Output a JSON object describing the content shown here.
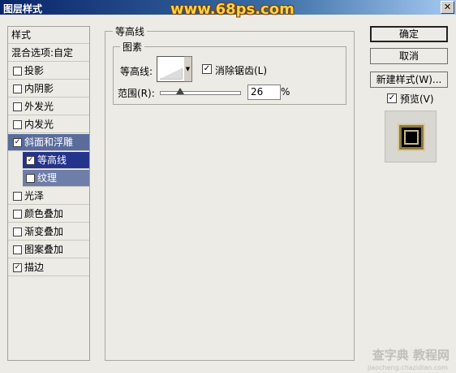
{
  "window": {
    "title": "图层样式",
    "watermark": "www.68ps.com",
    "close_glyph": "✕"
  },
  "styles_list": {
    "header": "样式",
    "blend": "混合选项:自定",
    "items": [
      {
        "label": "投影",
        "checked": false
      },
      {
        "label": "内阴影",
        "checked": false
      },
      {
        "label": "外发光",
        "checked": false
      },
      {
        "label": "内发光",
        "checked": false
      },
      {
        "label": "斜面和浮雕",
        "checked": true
      },
      {
        "label": "等高线",
        "checked": true
      },
      {
        "label": "纹理",
        "checked": false
      },
      {
        "label": "光泽",
        "checked": false
      },
      {
        "label": "颜色叠加",
        "checked": false
      },
      {
        "label": "渐变叠加",
        "checked": false
      },
      {
        "label": "图案叠加",
        "checked": false
      },
      {
        "label": "描边",
        "checked": true
      }
    ]
  },
  "contour_panel": {
    "group_title": "等高线",
    "sub_title": "图素",
    "contour_label": "等高线:",
    "antialias_label": "消除锯齿(L)",
    "antialias_checked": "✓",
    "range_label": "范围(R):",
    "range_value": "26",
    "range_unit": "%",
    "range_level_percent": 26
  },
  "buttons": {
    "ok": "确定",
    "cancel": "取消",
    "new_style": "新建样式(W)...",
    "preview_label": "预览(V)",
    "preview_checked": "✓"
  },
  "footer_watermark": {
    "line1": "查字典 教程网",
    "line2": "jiaocheng.chazidian.com"
  },
  "checkmark_glyph": "✓"
}
